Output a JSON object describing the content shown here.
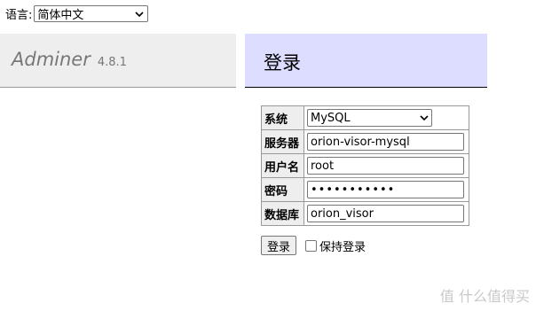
{
  "language": {
    "label": "语言:",
    "selected": "简体中文"
  },
  "brand": {
    "name": "Adminer",
    "version": "4.8.1"
  },
  "header": {
    "title": "登录"
  },
  "form": {
    "system": {
      "label": "系统",
      "value": "MySQL"
    },
    "server": {
      "label": "服务器",
      "value": "orion-visor-mysql"
    },
    "username": {
      "label": "用户名",
      "value": "root"
    },
    "password": {
      "label": "密码",
      "value": "•••••••••••"
    },
    "database": {
      "label": "数据库",
      "value": "orion_visor"
    }
  },
  "actions": {
    "login_label": "登录",
    "remember_label": "保持登录"
  },
  "watermark": {
    "text": "值 什么值得买"
  },
  "colors": {
    "header_bg": "#ddddff",
    "menu_bg": "#eeeeee"
  }
}
